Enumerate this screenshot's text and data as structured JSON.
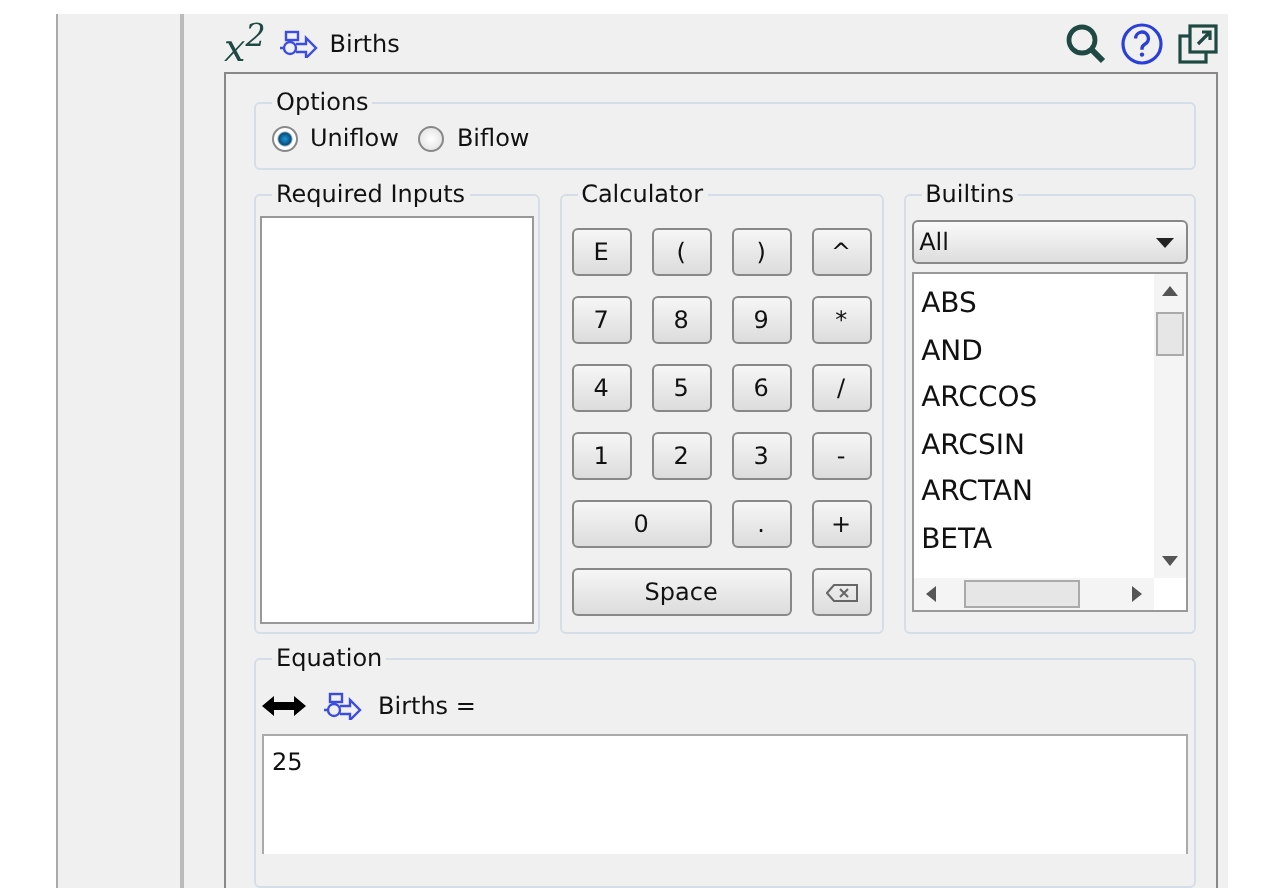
{
  "header": {
    "formula_label": "x$^{2}$",
    "title": "Births"
  },
  "options": {
    "title": "Options",
    "choices": [
      {
        "label": "Uniflow",
        "selected": true
      },
      {
        "label": "Biflow",
        "selected": false
      }
    ]
  },
  "required_inputs": {
    "title": "Required Inputs"
  },
  "calculator": {
    "title": "Calculator",
    "keys": [
      {
        "kind": "text",
        "label": "E"
      },
      {
        "kind": "text",
        "label": "("
      },
      {
        "kind": "text",
        "label": ")"
      },
      {
        "kind": "text",
        "label": "^"
      },
      {
        "kind": "text",
        "label": "7"
      },
      {
        "kind": "text",
        "label": "8"
      },
      {
        "kind": "text",
        "label": "9"
      },
      {
        "kind": "text",
        "label": "*"
      },
      {
        "kind": "text",
        "label": "4"
      },
      {
        "kind": "text",
        "label": "5"
      },
      {
        "kind": "text",
        "label": "6"
      },
      {
        "kind": "text",
        "label": "/"
      },
      {
        "kind": "text",
        "label": "1"
      },
      {
        "kind": "text",
        "label": "2"
      },
      {
        "kind": "text",
        "label": "3"
      },
      {
        "kind": "text",
        "label": "-"
      },
      {
        "kind": "wide",
        "label": "0"
      },
      {
        "kind": "text",
        "label": "."
      },
      {
        "kind": "text",
        "label": "+"
      },
      {
        "kind": "extra_wide",
        "label": "Space"
      },
      {
        "kind": "backspace"
      }
    ]
  },
  "builtins": {
    "title": "Builtins",
    "filter": "All",
    "items": [
      "ABS",
      "AND",
      "ARCCOS",
      "ARCSIN",
      "ARCTAN",
      "BETA"
    ]
  },
  "equation": {
    "title": "Equation",
    "lhs": "Births =",
    "value": "25"
  }
}
